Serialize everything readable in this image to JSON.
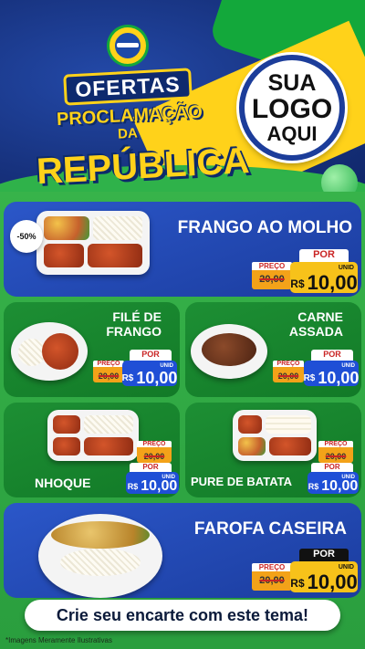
{
  "header": {
    "title_line1": "OFERTAS",
    "title_line2": "PROCLAMAÇÃO",
    "title_line3": "DA",
    "title_line4": "REPÚBLICA",
    "logo_line1": "SUA",
    "logo_line2": "LOGO",
    "logo_line3": "AQUI"
  },
  "products": [
    {
      "name": "FRANGO AO MOLHO",
      "badge": "-50%",
      "old_label": "PREÇO",
      "old_price": "20,00",
      "por": "POR",
      "currency": "R$",
      "price": "10,00",
      "unit": "UNID"
    },
    {
      "name_line1": "FILÉ DE",
      "name_line2": "FRANGO",
      "old_label": "PREÇO",
      "old_price": "20,00",
      "por": "POR",
      "currency": "R$",
      "price": "10,00",
      "unit": "UNID"
    },
    {
      "name_line1": "CARNE",
      "name_line2": "ASSADA",
      "old_label": "PREÇO",
      "old_price": "20,00",
      "por": "POR",
      "currency": "R$",
      "price": "10,00",
      "unit": "UNID"
    },
    {
      "name": "NHOQUE",
      "old_label": "PREÇO",
      "old_price": "20,00",
      "por": "POR",
      "currency": "R$",
      "price": "10,00",
      "unit": "UNID"
    },
    {
      "name": "PURE DE BATATA",
      "old_label": "PREÇO",
      "old_price": "20,00",
      "por": "POR",
      "currency": "R$",
      "price": "10,00",
      "unit": "UNID"
    },
    {
      "name": "FAROFA CASEIRA",
      "old_label": "PREÇO",
      "old_price": "20,00",
      "por": "POR",
      "currency": "R$",
      "price": "10,00",
      "unit": "UNID"
    }
  ],
  "cta": "Crie seu encarte com este tema!",
  "footnote": "*Imagens Meramente Ilustrativas",
  "colors": {
    "blue": "#1b3c9e",
    "green": "#37b34a",
    "yellow": "#ffd21a",
    "price_blue": "#1f4fd6",
    "price_yellow": "#f7c21a",
    "red": "#c92424"
  }
}
